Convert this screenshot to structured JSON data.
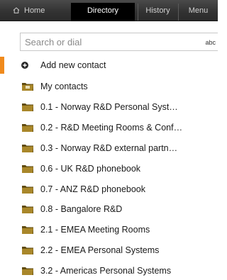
{
  "tabs": {
    "home": "Home",
    "directory": "Directory",
    "history": "History",
    "menu": "Menu"
  },
  "search": {
    "placeholder": "Search or dial",
    "mode": "abc"
  },
  "add_contact": "Add new contact",
  "folders": [
    {
      "label": "My contacts",
      "icon": "contacts-folder-icon"
    },
    {
      "label": "0.1 - Norway R&D Personal Syst…",
      "icon": "folder-icon"
    },
    {
      "label": "0.2 - R&D Meeting Rooms & Conf…",
      "icon": "folder-icon"
    },
    {
      "label": "0.3 - Norway R&D external partn…",
      "icon": "folder-icon"
    },
    {
      "label": "0.6 - UK R&D phonebook",
      "icon": "folder-icon"
    },
    {
      "label": "0.7 - ANZ R&D phonebook",
      "icon": "folder-icon"
    },
    {
      "label": "0.8 - Bangalore R&D",
      "icon": "folder-icon"
    },
    {
      "label": "2.1 - EMEA Meeting Rooms",
      "icon": "folder-icon"
    },
    {
      "label": "2.2 - EMEA Personal Systems",
      "icon": "folder-icon"
    },
    {
      "label": "3.2 - Americas Personal Systems",
      "icon": "folder-icon"
    }
  ],
  "colors": {
    "accent": "#f08a1c",
    "folder": "#8a6a16",
    "tab_bar": "#333333",
    "active_tab": "#000000"
  }
}
